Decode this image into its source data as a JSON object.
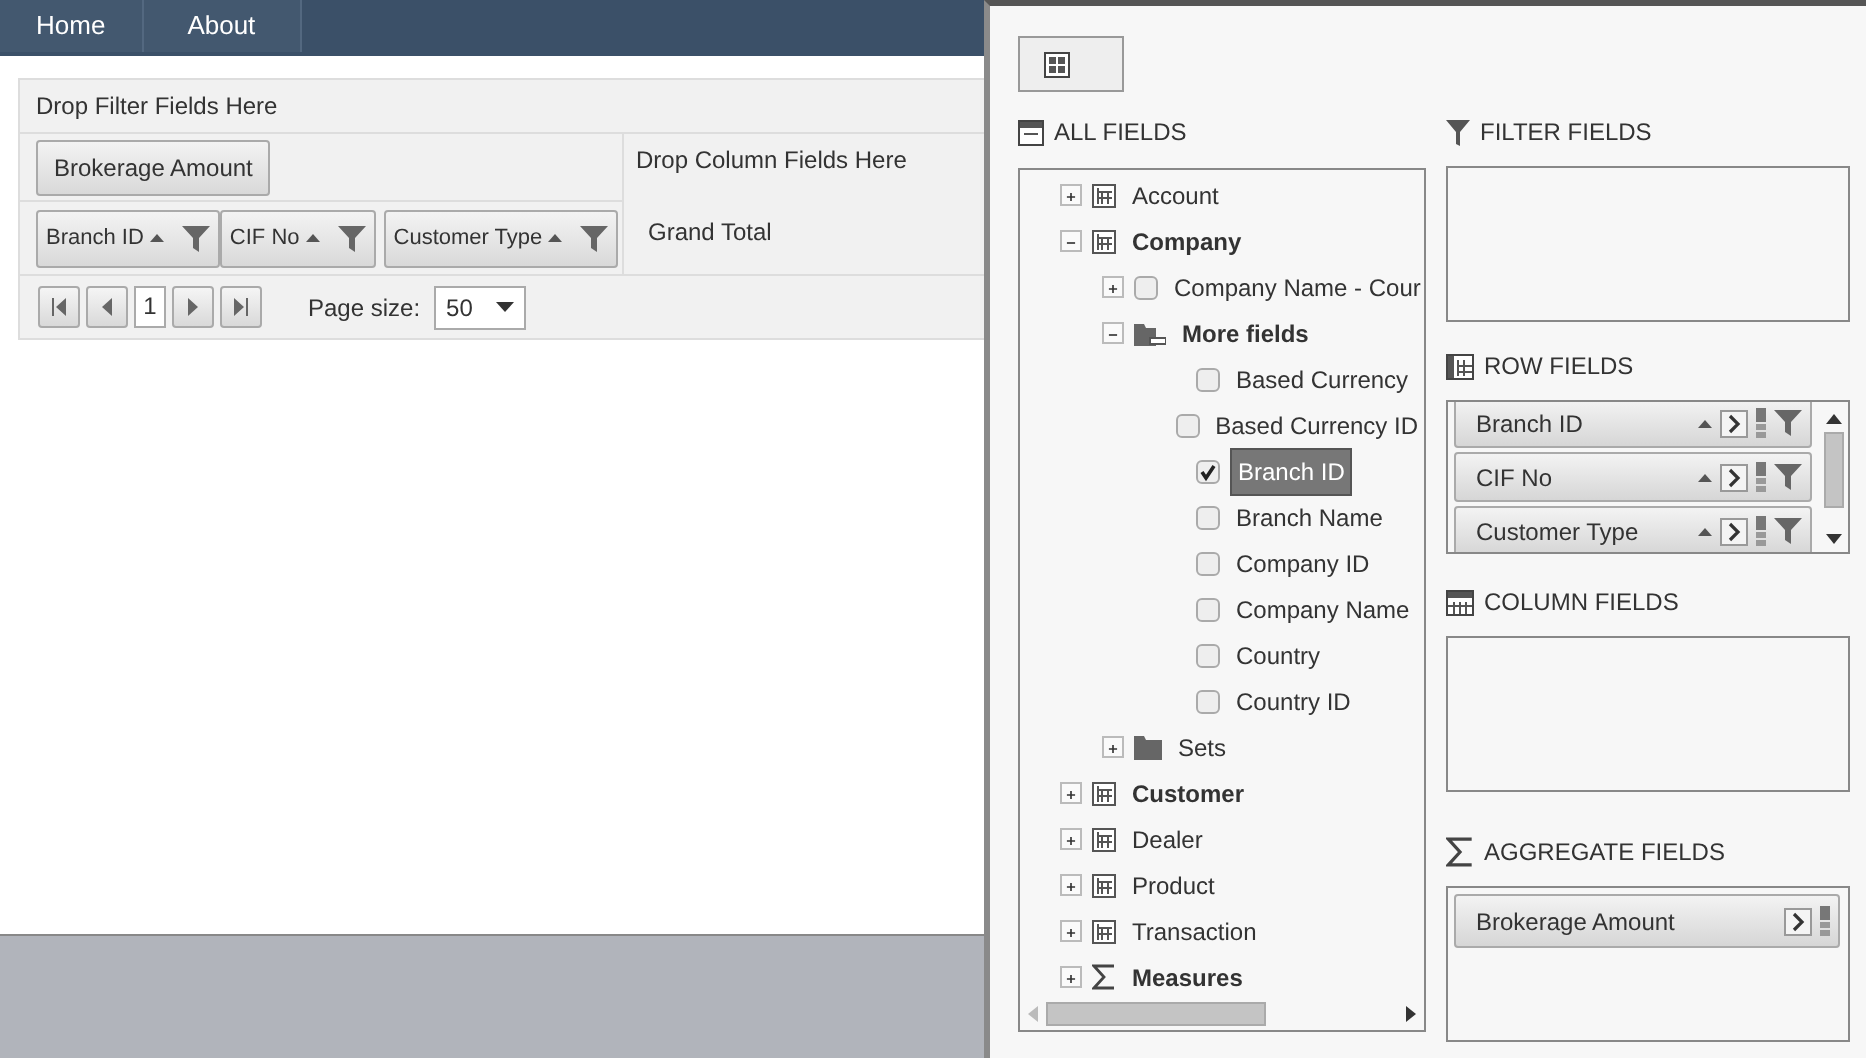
{
  "nav": [
    {
      "label": "Home"
    },
    {
      "label": "About"
    }
  ],
  "pivot": {
    "filter_zone": "Drop Filter Fields Here",
    "data_fields": [
      "Brokerage Amount"
    ],
    "column_zone": "Drop Column Fields Here",
    "row_fields": [
      "Branch ID",
      "CIF No",
      "Customer Type"
    ],
    "grand_total": "Grand Total",
    "pager": {
      "current_page": "1",
      "page_size_label": "Page size:",
      "page_size": "50"
    }
  },
  "field_list": {
    "all_fields_label": "ALL FIELDS",
    "tree": [
      {
        "label": "Account",
        "kind": "table",
        "expanded": false,
        "bold": false
      },
      {
        "label": "Company",
        "kind": "table",
        "expanded": true,
        "bold": true,
        "children": [
          {
            "label": "Company Name - Cour",
            "kind": "hierarchy",
            "expanded": false,
            "checked": false,
            "bold": false
          },
          {
            "label": "More fields",
            "kind": "folder",
            "expanded": true,
            "bold": true,
            "children": [
              {
                "label": "Based Currency",
                "kind": "field",
                "checked": false,
                "selected": false
              },
              {
                "label": "Based Currency ID",
                "kind": "field",
                "checked": false,
                "selected": false
              },
              {
                "label": "Branch ID",
                "kind": "field",
                "checked": true,
                "selected": true
              },
              {
                "label": "Branch Name",
                "kind": "field",
                "checked": false,
                "selected": false
              },
              {
                "label": "Company ID",
                "kind": "field",
                "checked": false,
                "selected": false
              },
              {
                "label": "Company Name",
                "kind": "field",
                "checked": false,
                "selected": false
              },
              {
                "label": "Country",
                "kind": "field",
                "checked": false,
                "selected": false
              },
              {
                "label": "Country ID",
                "kind": "field",
                "checked": false,
                "selected": false
              }
            ]
          },
          {
            "label": "Sets",
            "kind": "sets",
            "expanded": false,
            "bold": false
          }
        ]
      },
      {
        "label": "Customer",
        "kind": "table",
        "expanded": false,
        "bold": true
      },
      {
        "label": "Dealer",
        "kind": "table",
        "expanded": false,
        "bold": false
      },
      {
        "label": "Product",
        "kind": "table",
        "expanded": false,
        "bold": false
      },
      {
        "label": "Transaction",
        "kind": "table",
        "expanded": false,
        "bold": false
      },
      {
        "label": "Measures",
        "kind": "measures",
        "expanded": false,
        "bold": true
      }
    ],
    "filter_label": "FILTER FIELDS",
    "row_label": "ROW FIELDS",
    "row_fields": [
      "Branch ID",
      "CIF No",
      "Customer Type"
    ],
    "column_label": "COLUMN FIELDS",
    "aggregate_label": "AGGREGATE FIELDS",
    "aggregate_fields": [
      "Brokerage Amount"
    ]
  }
}
